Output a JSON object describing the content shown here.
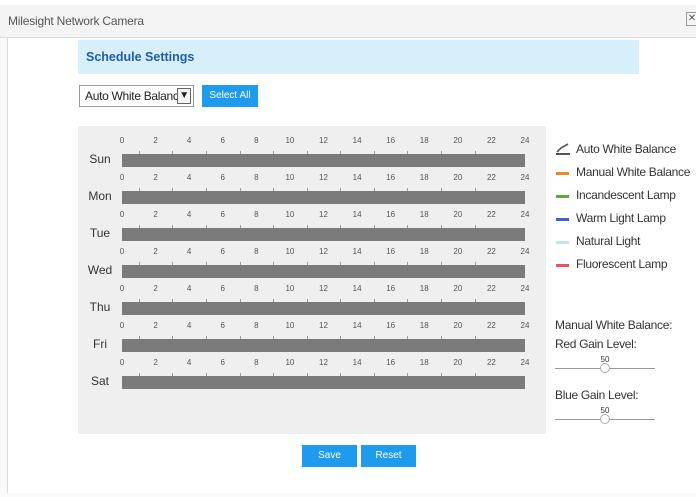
{
  "window": {
    "title": "Milesight Network Camera",
    "close_label": "✕"
  },
  "section": {
    "title": "Schedule Settings"
  },
  "controls": {
    "mode_value": "Auto White Balance",
    "select_all_label": "Select All"
  },
  "schedule": {
    "hours": [
      "0",
      "2",
      "4",
      "6",
      "8",
      "10",
      "12",
      "14",
      "16",
      "18",
      "20",
      "22",
      "24"
    ],
    "days": [
      {
        "label": "Sun"
      },
      {
        "label": "Mon"
      },
      {
        "label": "Tue"
      },
      {
        "label": "Wed"
      },
      {
        "label": "Thu"
      },
      {
        "label": "Fri"
      },
      {
        "label": "Sat"
      }
    ]
  },
  "legend": [
    {
      "label": "Auto White Balance",
      "color": "#555555",
      "icon": "brush-icon"
    },
    {
      "label": "Manual White Balance",
      "color": "#f08a1c"
    },
    {
      "label": "Incandescent Lamp",
      "color": "#5aab3c"
    },
    {
      "label": "Warm Light Lamp",
      "color": "#3b63d8"
    },
    {
      "label": "Natural Light",
      "color": "#bfe3f6"
    },
    {
      "label": "Fluorescent Lamp",
      "color": "#e8536a"
    }
  ],
  "manual_wb": {
    "title": "Manual White Balance:",
    "red_label": "Red Gain Level:",
    "red_value": "50",
    "blue_label": "Blue Gain Level:",
    "blue_value": "50"
  },
  "footer": {
    "save_label": "Save",
    "reset_label": "Reset"
  },
  "colors": {
    "accent": "#1e9bec",
    "header_bg": "#d7eefb",
    "bar": "#7b7b7b"
  }
}
